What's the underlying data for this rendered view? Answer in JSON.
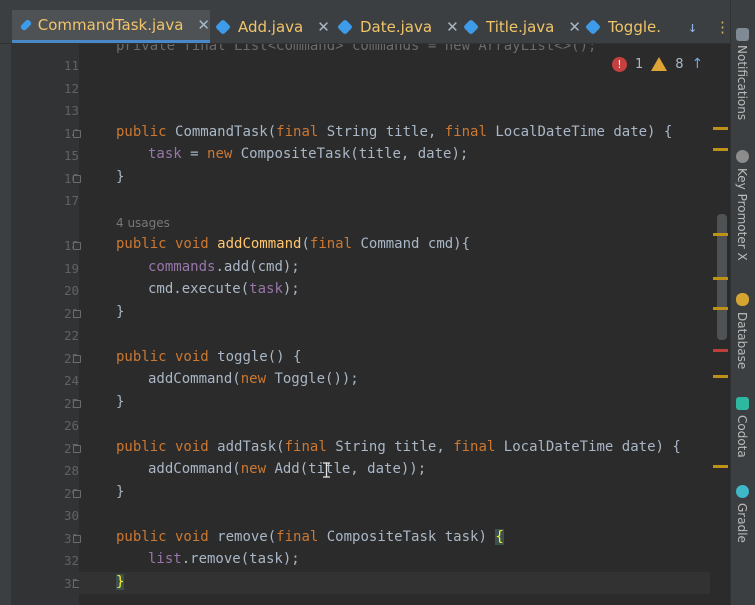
{
  "tabs": [
    {
      "label": "CommandTask.java",
      "active": true
    },
    {
      "label": "Add.java",
      "active": false
    },
    {
      "label": "Date.java",
      "active": false
    },
    {
      "label": "Title.java",
      "active": false
    },
    {
      "label": "Toggle.",
      "active": false
    }
  ],
  "tab_close_glyph": "✕",
  "tab_tools": {
    "down_arrow": "↓",
    "more": "⋮"
  },
  "inspections": {
    "errors": "1",
    "warnings": "8",
    "up": "↑",
    "down": "↓"
  },
  "usages_hint": "4 usages",
  "line_numbers": [
    "11",
    "12",
    "13",
    "14",
    "15",
    "16",
    "17",
    "18",
    "19",
    "20",
    "21",
    "22",
    "23",
    "24",
    "25",
    "26",
    "27",
    "28",
    "29",
    "30",
    "31",
    "32",
    "33"
  ],
  "code": {
    "partial_top": "private final List<Command> commands = new ArrayList<>();",
    "l14_a": "public ",
    "l14_b": "CommandTask",
    "l14_c": "(",
    "l14_d": "final ",
    "l14_e": "String title, ",
    "l14_f": "final ",
    "l14_g": "LocalDateTime date) {",
    "l15_a": "task",
    "l15_b": " = ",
    "l15_c": "new ",
    "l15_d": "CompositeTask(title, date);",
    "l16": "}",
    "l18_a": "public void ",
    "l18_b": "addCommand",
    "l18_c": "(",
    "l18_d": "final ",
    "l18_e": "Command cmd){",
    "l19_a": "commands",
    "l19_b": ".add(cmd);",
    "l20_a": "cmd.execute(",
    "l20_b": "task",
    "l20_c": ");",
    "l21": "}",
    "l23_a": "public void ",
    "l23_b": "toggle",
    "l23_c": "() {",
    "l24_a": "addCommand(",
    "l24_b": "new ",
    "l24_c": "Toggle());",
    "l25": "}",
    "l27_a": "public void ",
    "l27_b": "addTask",
    "l27_c": "(",
    "l27_d": "final ",
    "l27_e": "String title, ",
    "l27_f": "final ",
    "l27_g": "LocalDateTime date) {",
    "l28_a": "addCommand(",
    "l28_b": "new ",
    "l28_c": "Add(title, date));",
    "l29": "}",
    "l31_a": "public void ",
    "l31_b": "remove",
    "l31_c": "(",
    "l31_d": "final ",
    "l31_e": "CompositeTask task) ",
    "l31_f": "{",
    "l32_a": "list",
    "l32_b": ".remove(task);",
    "l33": "}"
  },
  "tool_windows": [
    "Notifications",
    "Key Promoter X",
    "Database",
    "Codota",
    "Gradle"
  ],
  "colors": {
    "keyword": "#cc7832",
    "method": "#ffc66d",
    "field": "#9876aa",
    "text": "#a9b7c6",
    "tab_text": "#f0c46a",
    "accent": "#4a88c7"
  }
}
